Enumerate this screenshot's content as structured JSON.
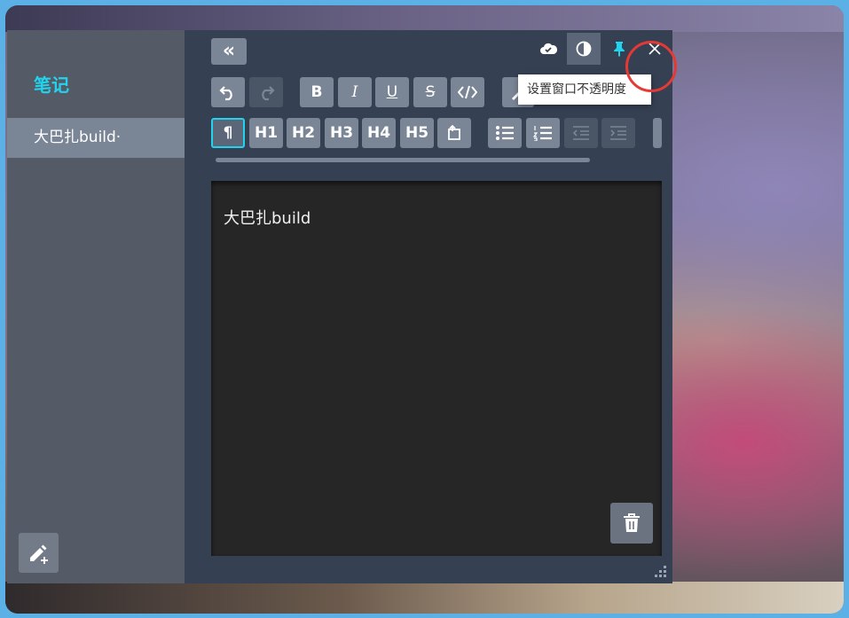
{
  "app": {
    "sidebar_title": "笔记",
    "notes": [
      {
        "title": "大巴扎build·",
        "selected": true
      }
    ]
  },
  "toolbar": {
    "collapse_label": "«",
    "format_buttons": [
      {
        "label": "B",
        "name": "bold-button"
      },
      {
        "label": "I",
        "name": "italic-button"
      },
      {
        "label": "U",
        "name": "underline-button"
      },
      {
        "label": "S",
        "name": "strikethrough-button"
      }
    ],
    "heading_buttons": [
      "H1",
      "H2",
      "H3",
      "H4",
      "H5"
    ],
    "paragraph_label": "¶"
  },
  "top_icons": [
    "sync-cloud-icon",
    "opacity-icon",
    "pin-icon",
    "close-icon"
  ],
  "tooltip": "设置窗口不透明度",
  "editor": {
    "content": "大巴扎build"
  },
  "colors": {
    "accent": "#22d3ee",
    "sidebar": "#545a66",
    "editor_panel": "#354052",
    "content_bg": "#262626",
    "highlight_ring": "#e53935"
  }
}
